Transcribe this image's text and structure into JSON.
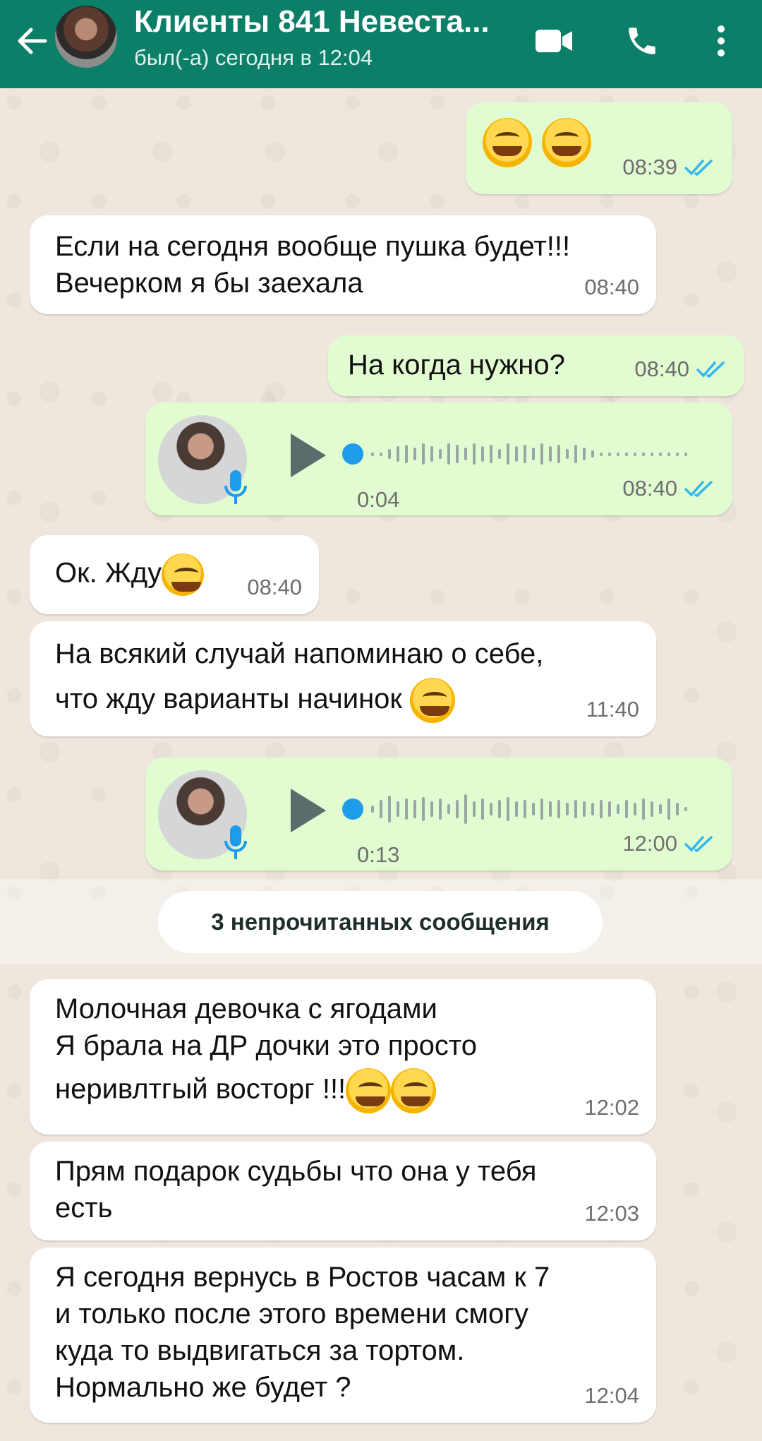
{
  "header": {
    "title": "Клиенты 841 Невеста...",
    "status": "был(-а) сегодня в 12:04"
  },
  "messages": [
    {
      "type": "out-emoji",
      "time": "08:39"
    },
    {
      "type": "in",
      "lines": [
        "Если на сегодня вообще пушка будет!!!",
        "Вечерком я бы заехала"
      ],
      "time": "08:40"
    },
    {
      "type": "out",
      "text": "На когда нужно?",
      "time": "08:40"
    },
    {
      "type": "voice",
      "duration": "0:04",
      "time": "08:40",
      "progress": 0
    },
    {
      "type": "in",
      "text": "Ок. Жду",
      "time": "08:40"
    },
    {
      "type": "in",
      "lines": [
        "На всякий случай напоминаю о себе,",
        "что жду варианты начинок"
      ],
      "time": "11:40"
    },
    {
      "type": "voice",
      "duration": "0:13",
      "time": "12:00",
      "progress": 0
    },
    {
      "type": "in",
      "lines": [
        "Молочная девочка с ягодами",
        "Я брала на ДР дочки это просто",
        "неривлтгый восторг !!!"
      ],
      "time": "12:02"
    },
    {
      "type": "in",
      "lines": [
        "Прям подарок судьбы что она у тебя",
        "есть"
      ],
      "time": "12:03"
    },
    {
      "type": "in",
      "lines": [
        "Я сегодня вернусь в Ростов часам к 7",
        "и только после этого времени смогу",
        "куда то выдвигаться за тортом.",
        "Нормально же будет ?"
      ],
      "time": "12:04"
    }
  ],
  "unread_banner": "3 непрочитанных сообщения",
  "colors": {
    "header": "#0b7f68",
    "outgoing": "#e2fcd1",
    "incoming": "#ffffff",
    "ticks": "#34b7f1",
    "voice_accent": "#1e9be9"
  }
}
